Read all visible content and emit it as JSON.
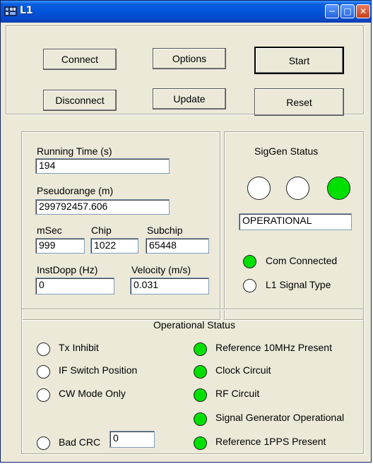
{
  "window": {
    "title": "L1"
  },
  "controls": {
    "connect": "Connect",
    "options": "Options",
    "start": "Start",
    "disconnect": "Disconnect",
    "update": "Update",
    "reset": "Reset"
  },
  "readouts": {
    "running_time_label": "Running Time (s)",
    "running_time": "194",
    "pseudorange_label": "Pseudorange (m)",
    "pseudorange": "299792457.606",
    "msec_label": "mSec",
    "msec": "999",
    "chip_label": "Chip",
    "chip": "1022",
    "subchip_label": "Subchip",
    "subchip": "65448",
    "instdopp_label": "InstDopp (Hz)",
    "instdopp": "0",
    "velocity_label": "Velocity (m/s)",
    "velocity": "0.031"
  },
  "siggen": {
    "title": "SigGen Status",
    "leds": [
      {
        "name": "siggen-led-1",
        "on": false
      },
      {
        "name": "siggen-led-2",
        "on": false
      },
      {
        "name": "siggen-led-3",
        "on": true
      }
    ],
    "status_text": "OPERATIONAL",
    "com_connected_label": "Com Connected",
    "com_connected": true,
    "l1_signal_type_label": "L1 Signal Type",
    "l1_signal_type": false
  },
  "operational": {
    "title": "Operational Status",
    "left": [
      {
        "label": "Tx Inhibit",
        "on": false
      },
      {
        "label": "IF Switch Position",
        "on": false
      },
      {
        "label": "CW Mode Only",
        "on": false
      }
    ],
    "bad_crc_label": "Bad CRC",
    "bad_crc_on": false,
    "bad_crc_value": "0",
    "right": [
      {
        "label": "Reference 10MHz Present",
        "on": true
      },
      {
        "label": "Clock Circuit",
        "on": true
      },
      {
        "label": "RF Circuit",
        "on": true
      },
      {
        "label": "Signal Generator Operational",
        "on": true
      },
      {
        "label": "Reference 1PPS Present",
        "on": true
      }
    ]
  },
  "colors": {
    "led_on": "#00e000",
    "led_off": "#ffffff",
    "titlebar": "#0454da",
    "face": "#ece9d8"
  }
}
